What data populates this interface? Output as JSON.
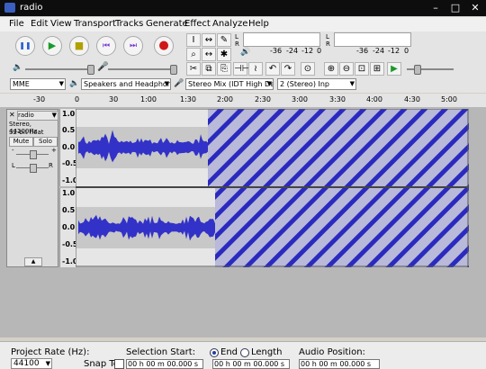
{
  "window": {
    "title": "radio",
    "min": "–",
    "max": "□",
    "close": "✕"
  },
  "menu": [
    "File",
    "Edit",
    "View",
    "Transport",
    "Tracks",
    "Generate",
    "Effect",
    "Analyze",
    "Help"
  ],
  "transport": {
    "pause": "❚❚",
    "play": "▶",
    "stop": "■",
    "skip_start": "⏮",
    "skip_end": "⏭",
    "record": "●"
  },
  "tools": {
    "select": "I",
    "envelope": "↭",
    "draw": "✎",
    "zoom": "⌕",
    "timeshift": "↔",
    "multi": "✱"
  },
  "meters": {
    "record": {
      "l": "L",
      "r": "R",
      "ticks": [
        "-36",
        "-24",
        "-12",
        "0"
      ]
    },
    "play": {
      "l": "L",
      "r": "R",
      "ticks": [
        "-36",
        "-24",
        "-12",
        "0"
      ]
    }
  },
  "edit_tools": [
    "✂",
    "⧉",
    "⎘",
    "⊣⊢",
    "≀",
    "↶",
    "↷",
    "⊙",
    "⊕",
    "⊖",
    "⊡",
    "⊞",
    "▶"
  ],
  "device": {
    "host": "MME",
    "playback": "Speakers and Headphone",
    "recording": "Stereo Mix (IDT High Def",
    "channels": "2 (Stereo) Inp"
  },
  "ruler_ticks": [
    "-30",
    "0",
    "30",
    "1:00",
    "1:30",
    "2:00",
    "2:30",
    "3:00",
    "3:30",
    "4:00",
    "4:30",
    "5:00"
  ],
  "track": {
    "name": "radio",
    "info1": "Stereo, 44100Hz",
    "info2": "32-bit float",
    "mute": "Mute",
    "solo": "Solo",
    "minus": "-",
    "plus": "+",
    "left": "L",
    "right": "R",
    "collapse": "▲",
    "scale": [
      "1.0",
      "0.5",
      "0.0",
      "-0.5",
      "-1.0"
    ]
  },
  "status": {
    "project_rate_label": "Project Rate (Hz):",
    "project_rate": "44100",
    "snap_to": "Snap To",
    "selection_start_label": "Selection Start:",
    "end_label": "End",
    "length_label": "Length",
    "audio_position_label": "Audio Position:",
    "start_time": "00 h 00 m 00.000 s",
    "end_time": "00 h 00 m 00.000 s",
    "audio_position": "00 h 00 m 00.000 s"
  },
  "colors": {
    "wave": "#3232c8",
    "selection": "#b4b4dc",
    "hatch": "#2a2abf"
  }
}
